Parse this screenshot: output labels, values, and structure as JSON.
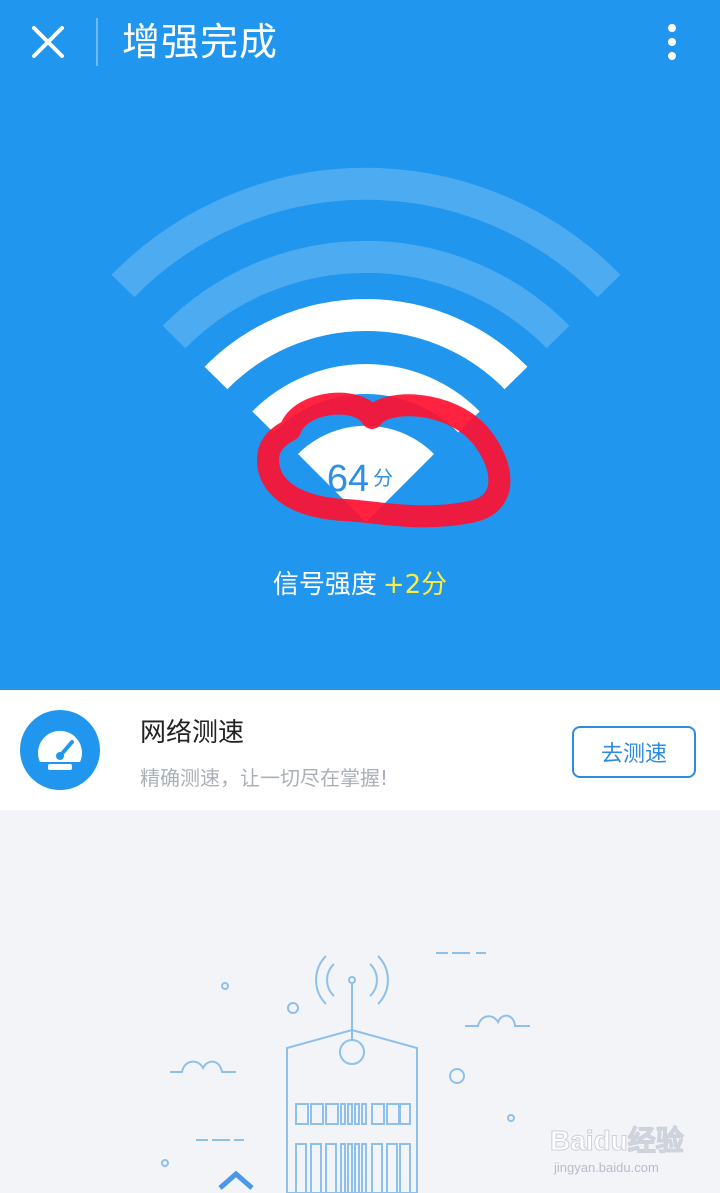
{
  "header": {
    "title": "增强完成",
    "close_icon": "close-icon",
    "more_icon": "more-vertical-icon"
  },
  "result": {
    "score_value": "64",
    "score_unit": "分",
    "signal_label": "信号强度",
    "signal_delta": "+2分"
  },
  "speed_test": {
    "icon": "speedometer-icon",
    "title": "网络测速",
    "subtitle": "精确测速，让一切尽在掌握!",
    "button_label": "去测速"
  },
  "watermark": {
    "text": "Baidu经验",
    "url": "jingyan.baidu.com"
  },
  "colors": {
    "primary_blue": "#2196ee",
    "delta_yellow": "#ffec3d",
    "button_blue": "#2d8be0",
    "annotation_red": "#ff1030",
    "background_gray": "#f3f4f8"
  }
}
